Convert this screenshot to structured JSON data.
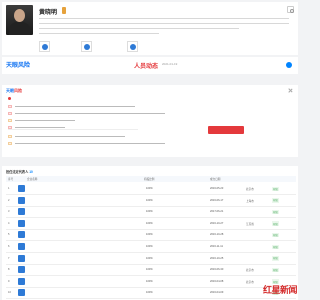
{
  "profile": {
    "name": "黄晓明",
    "badge": "",
    "description_note": "",
    "related_companies": [
      {
        "name": "",
        "sub": ""
      },
      {
        "name": "",
        "sub": ""
      },
      {
        "name": "",
        "sub": ""
      }
    ],
    "more_link": ""
  },
  "tabs": {
    "brand": "天眼风险",
    "items": [
      {
        "number": "",
        "label": ""
      },
      {
        "number": "",
        "label": ""
      },
      {
        "number": "",
        "label": ""
      },
      {
        "number": "",
        "label": ""
      },
      {
        "number": "",
        "label": ""
      }
    ],
    "risk_title": "人员动态",
    "risk_date": "2021-01-19",
    "risk_text": ""
  },
  "risk_panel": {
    "brand_prefix": "天眼",
    "brand_suffix": "风险",
    "alert_text": "",
    "rows": [
      {
        "tag": ""
      },
      {
        "tag": ""
      },
      {
        "tag": ""
      },
      {
        "tag": ""
      },
      {
        "tag": ""
      },
      {
        "tag": ""
      }
    ],
    "action_button": ""
  },
  "table": {
    "title": "担任法定代表人",
    "count": "10",
    "tools": "",
    "headers": [
      "序号",
      "企业名称",
      "",
      "持股比例",
      "",
      "成立日期",
      "",
      "",
      ""
    ],
    "rows": [
      {
        "idx": "1",
        "company": "",
        "pct": "100%",
        "date": "2016-05-23",
        "region": "北京市",
        "status": "存续"
      },
      {
        "idx": "2",
        "company": "",
        "pct": "100%",
        "date": "2016-06-17",
        "region": "上海市",
        "status": "存续"
      },
      {
        "idx": "3",
        "company": "",
        "pct": "100%",
        "date": "2017-06-21",
        "region": "",
        "status": "存续"
      },
      {
        "idx": "4",
        "company": "",
        "pct": "100%",
        "date": "2016-10-27",
        "region": "江苏省",
        "status": "存续"
      },
      {
        "idx": "5",
        "company": "",
        "pct": "100%",
        "date": "2016-10-28",
        "region": "",
        "status": "存续"
      },
      {
        "idx": "6",
        "company": "",
        "pct": "100%",
        "date": "2016-11-11",
        "region": "",
        "status": "存续"
      },
      {
        "idx": "7",
        "company": "",
        "pct": "100%",
        "date": "2016-10-25",
        "region": "",
        "status": "存续"
      },
      {
        "idx": "8",
        "company": "",
        "pct": "100%",
        "date": "2016-06-30",
        "region": "北京市",
        "status": "存续"
      },
      {
        "idx": "9",
        "company": "",
        "pct": "100%",
        "date": "2016-04-08",
        "region": "北京市",
        "status": "存续"
      },
      {
        "idx": "10",
        "company": "",
        "pct": "100%",
        "date": "2016-04-09",
        "region": "",
        "status": "存续"
      }
    ]
  },
  "watermark": {
    "main": "红星新闻",
    "sub": ""
  }
}
